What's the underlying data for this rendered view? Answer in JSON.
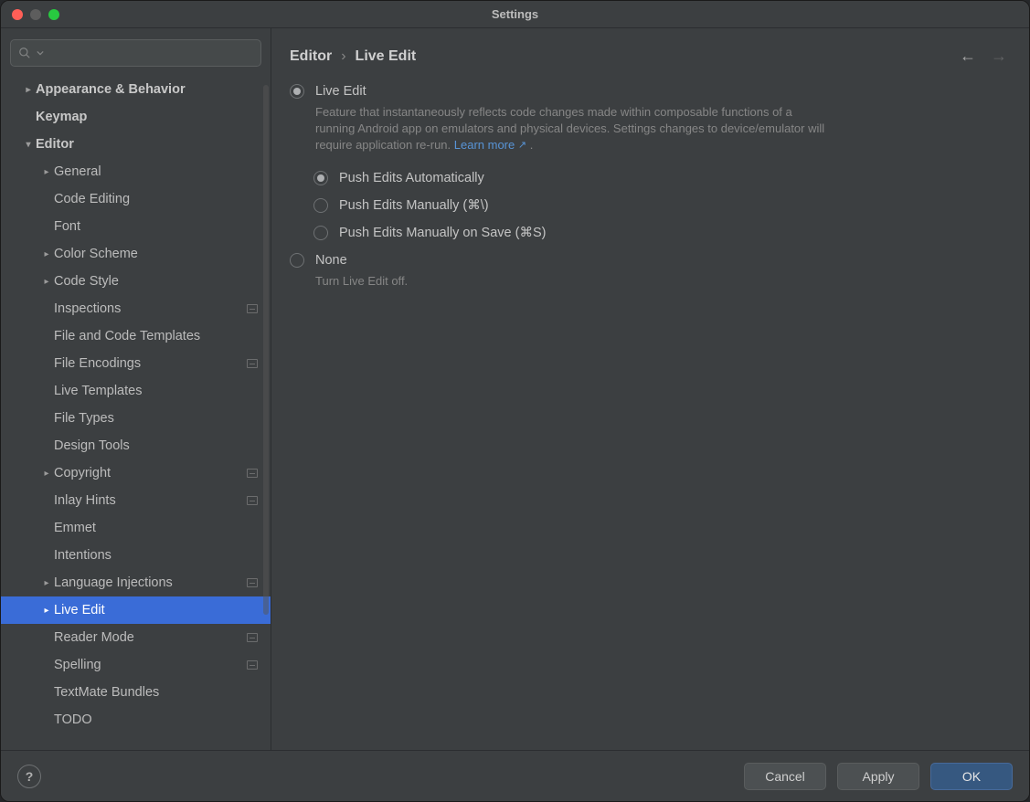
{
  "title": "Settings",
  "search": {
    "placeholder": ""
  },
  "sidebar": {
    "items": [
      {
        "label": "Appearance & Behavior",
        "indent": 0,
        "chevron": "right",
        "bold": true,
        "badge": false
      },
      {
        "label": "Keymap",
        "indent": 0,
        "chevron": "",
        "bold": true,
        "badge": false,
        "pad": true
      },
      {
        "label": "Editor",
        "indent": 0,
        "chevron": "down",
        "bold": true,
        "badge": false
      },
      {
        "label": "General",
        "indent": 1,
        "chevron": "right",
        "bold": false,
        "badge": false
      },
      {
        "label": "Code Editing",
        "indent": 1,
        "chevron": "",
        "bold": false,
        "badge": false
      },
      {
        "label": "Font",
        "indent": 1,
        "chevron": "",
        "bold": false,
        "badge": false
      },
      {
        "label": "Color Scheme",
        "indent": 1,
        "chevron": "right",
        "bold": false,
        "badge": false
      },
      {
        "label": "Code Style",
        "indent": 1,
        "chevron": "right",
        "bold": false,
        "badge": false
      },
      {
        "label": "Inspections",
        "indent": 1,
        "chevron": "",
        "bold": false,
        "badge": true
      },
      {
        "label": "File and Code Templates",
        "indent": 1,
        "chevron": "",
        "bold": false,
        "badge": false
      },
      {
        "label": "File Encodings",
        "indent": 1,
        "chevron": "",
        "bold": false,
        "badge": true
      },
      {
        "label": "Live Templates",
        "indent": 1,
        "chevron": "",
        "bold": false,
        "badge": false
      },
      {
        "label": "File Types",
        "indent": 1,
        "chevron": "",
        "bold": false,
        "badge": false
      },
      {
        "label": "Design Tools",
        "indent": 1,
        "chevron": "",
        "bold": false,
        "badge": false
      },
      {
        "label": "Copyright",
        "indent": 1,
        "chevron": "right",
        "bold": false,
        "badge": true
      },
      {
        "label": "Inlay Hints",
        "indent": 1,
        "chevron": "",
        "bold": false,
        "badge": true
      },
      {
        "label": "Emmet",
        "indent": 1,
        "chevron": "",
        "bold": false,
        "badge": false
      },
      {
        "label": "Intentions",
        "indent": 1,
        "chevron": "",
        "bold": false,
        "badge": false
      },
      {
        "label": "Language Injections",
        "indent": 1,
        "chevron": "right",
        "bold": false,
        "badge": true
      },
      {
        "label": "Live Edit",
        "indent": 1,
        "chevron": "right",
        "bold": false,
        "badge": false,
        "selected": true
      },
      {
        "label": "Reader Mode",
        "indent": 1,
        "chevron": "",
        "bold": false,
        "badge": true
      },
      {
        "label": "Spelling",
        "indent": 1,
        "chevron": "",
        "bold": false,
        "badge": true
      },
      {
        "label": "TextMate Bundles",
        "indent": 1,
        "chevron": "",
        "bold": false,
        "badge": false
      },
      {
        "label": "TODO",
        "indent": 1,
        "chevron": "",
        "bold": false,
        "badge": false
      }
    ]
  },
  "breadcrumb": {
    "root": "Editor",
    "sep": "›",
    "leaf": "Live Edit"
  },
  "options": {
    "group": {
      "selected": "live_edit",
      "live_edit": {
        "label": "Live Edit",
        "desc_pre": "Feature that instantaneously reflects code changes made within composable functions of a running Android app on emulators and physical devices. Settings changes to device/emulator will require application re-run. ",
        "learn_more": "Learn more",
        "desc_post": " .",
        "sub_selected": "auto",
        "auto": {
          "label": "Push Edits Automatically"
        },
        "manual": {
          "label": "Push Edits Manually (⌘\\)"
        },
        "onsave": {
          "label": "Push Edits Manually on Save (⌘S)"
        }
      },
      "none": {
        "label": "None",
        "desc": "Turn Live Edit off."
      }
    }
  },
  "footer": {
    "help_label": "?",
    "cancel": "Cancel",
    "apply": "Apply",
    "ok": "OK"
  }
}
